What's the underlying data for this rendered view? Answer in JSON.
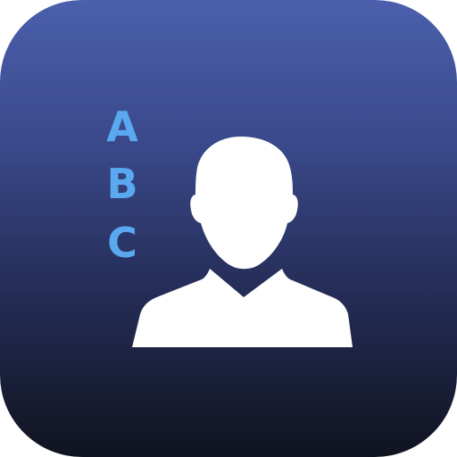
{
  "icon": {
    "letters": [
      "A",
      "B",
      "C"
    ],
    "letter_color": "#5aa9f0",
    "glyph": "person-silhouette-icon",
    "glyph_color": "#ffffff",
    "background_top": "#4b5fac",
    "background_bottom": "#10131f"
  }
}
